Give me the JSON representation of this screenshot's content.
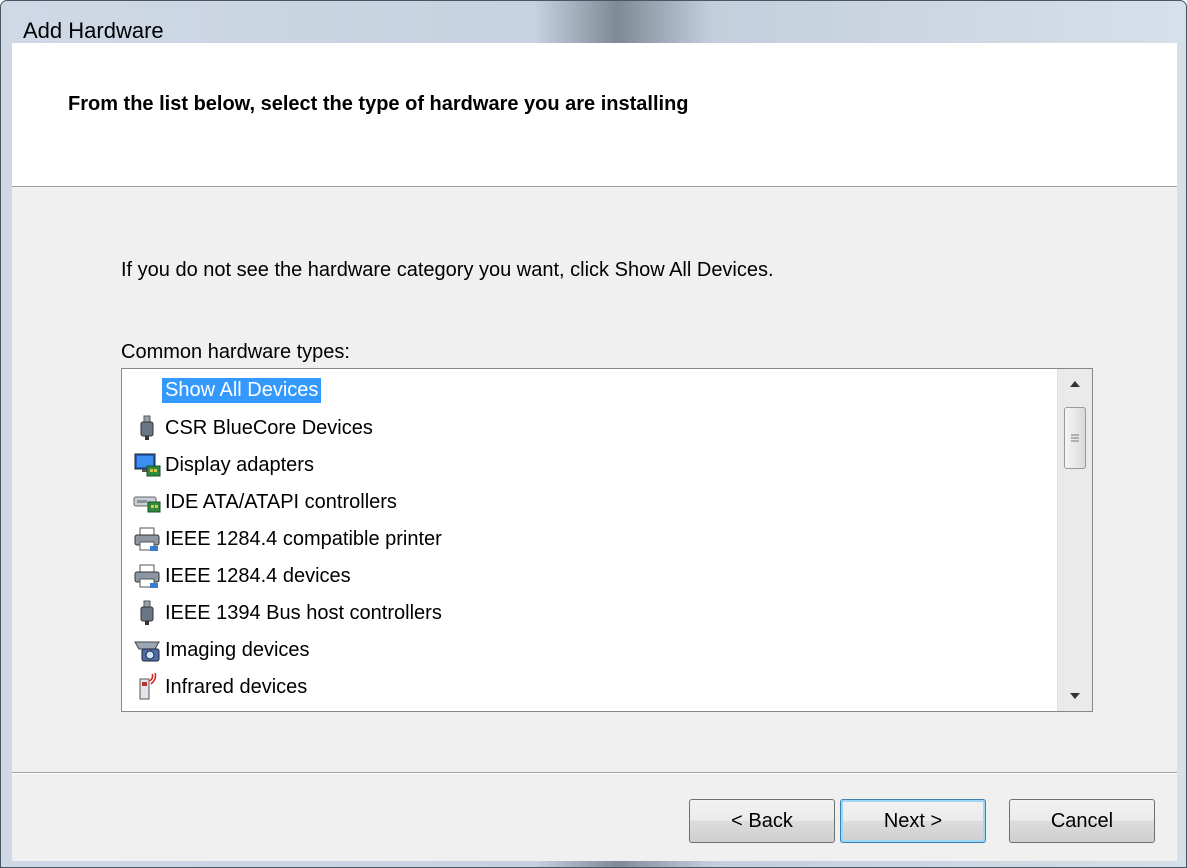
{
  "window": {
    "title": "Add Hardware"
  },
  "header": {
    "title": "From the list below, select the type of hardware you are installing"
  },
  "instruction": "If you do not see the hardware category you want, click Show All Devices.",
  "list": {
    "label": "Common hardware types:",
    "selected_index": 0,
    "items": [
      {
        "label": "Show All Devices",
        "icon": "none"
      },
      {
        "label": "CSR BlueCore Devices",
        "icon": "usb-icon"
      },
      {
        "label": "Display adapters",
        "icon": "display-adapter-icon"
      },
      {
        "label": "IDE ATA/ATAPI controllers",
        "icon": "ide-controller-icon"
      },
      {
        "label": "IEEE 1284.4 compatible printer",
        "icon": "printer-icon"
      },
      {
        "label": "IEEE 1284.4 devices",
        "icon": "printer-icon"
      },
      {
        "label": "IEEE 1394 Bus host controllers",
        "icon": "usb-icon"
      },
      {
        "label": "Imaging devices",
        "icon": "camera-icon"
      },
      {
        "label": "Infrared devices",
        "icon": "infrared-icon"
      }
    ]
  },
  "buttons": {
    "back": "< Back",
    "next": "Next >",
    "cancel": "Cancel"
  },
  "colors": {
    "selection": "#3399ff",
    "dialog_bg": "#f0f0f0",
    "header_bg": "#ffffff"
  }
}
